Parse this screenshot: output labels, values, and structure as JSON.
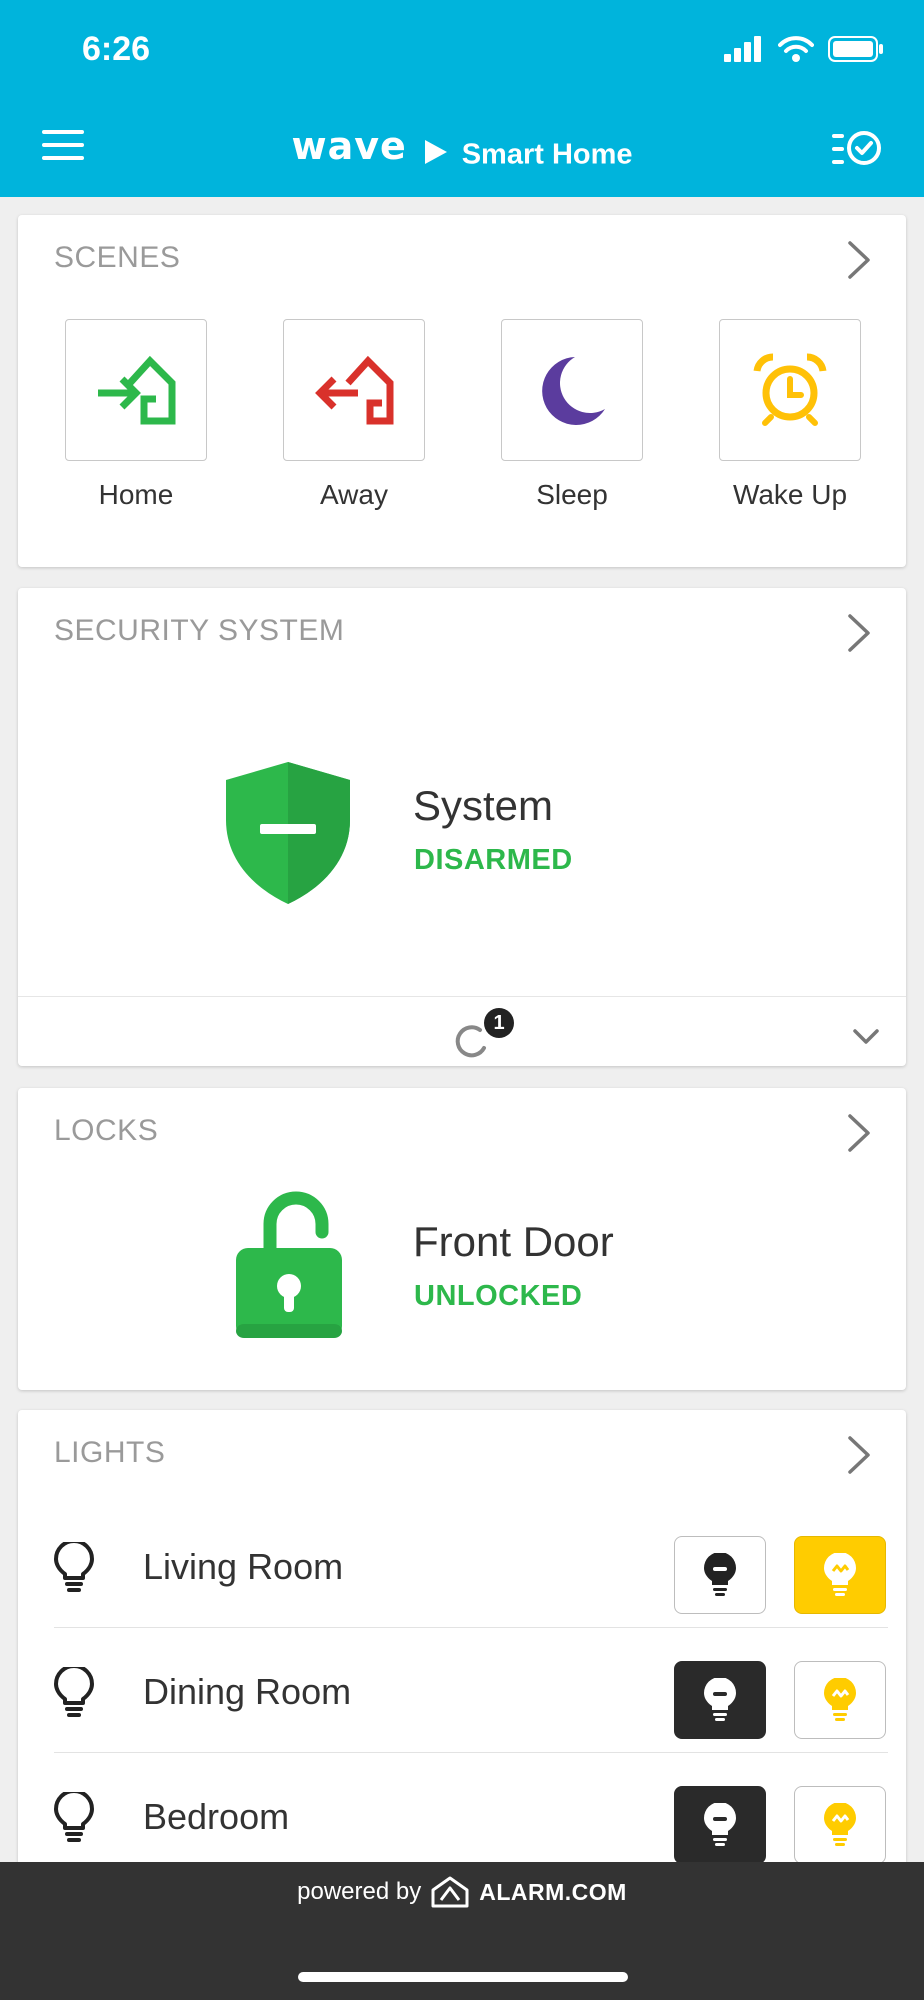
{
  "status_bar": {
    "time": "6:26"
  },
  "header": {
    "brand_wave": "wave",
    "brand_name": "Smart Home"
  },
  "scenes": {
    "title": "SCENES",
    "items": [
      {
        "label": "Home",
        "icon": "home-arrive-icon",
        "color": "#2db84b"
      },
      {
        "label": "Away",
        "icon": "home-leave-icon",
        "color": "#d9312b"
      },
      {
        "label": "Sleep",
        "icon": "moon-icon",
        "color": "#5b3c9e"
      },
      {
        "label": "Wake Up",
        "icon": "alarm-clock-icon",
        "color": "#ffc107"
      }
    ]
  },
  "security": {
    "title": "SECURITY SYSTEM",
    "device_name": "System",
    "status": "DISARMED",
    "pending_count": "1"
  },
  "locks": {
    "title": "LOCKS",
    "device_name": "Front Door",
    "status": "UNLOCKED"
  },
  "lights": {
    "title": "LIGHTS",
    "items": [
      {
        "name": "Living Room",
        "state": "on"
      },
      {
        "name": "Dining Room",
        "state": "off"
      },
      {
        "name": "Bedroom",
        "state": "off"
      }
    ]
  },
  "footer": {
    "powered_by": "powered by",
    "provider": "ALARM.COM"
  },
  "colors": {
    "header_bg": "#00b4dc",
    "status_green": "#2db84b",
    "light_on_yellow": "#ffcc00",
    "light_off_dark": "#2a2a2a"
  }
}
